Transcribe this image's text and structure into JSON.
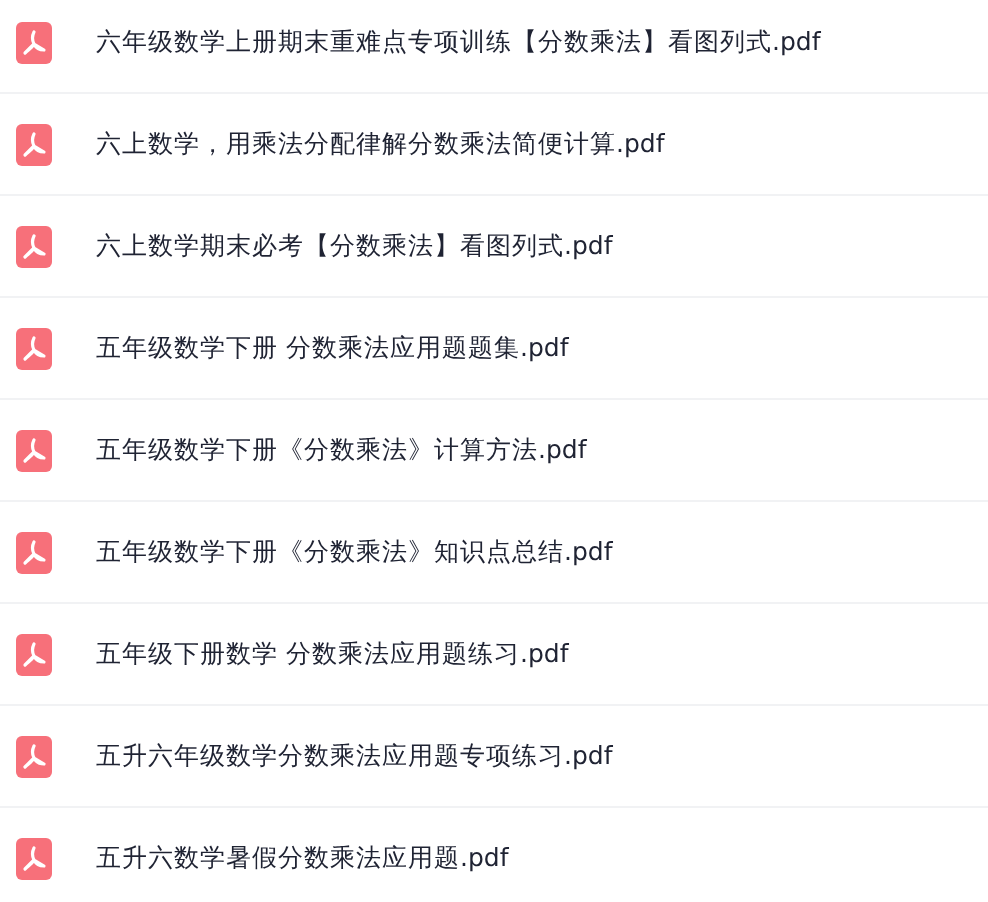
{
  "files": [
    {
      "name": "六年级数学上册期末重难点专项训练【分数乘法】看图列式.pdf"
    },
    {
      "name": "六上数学，用乘法分配律解分数乘法简便计算.pdf"
    },
    {
      "name": "六上数学期末必考【分数乘法】看图列式.pdf"
    },
    {
      "name": "五年级数学下册 分数乘法应用题题集.pdf"
    },
    {
      "name": "五年级数学下册《分数乘法》计算方法.pdf"
    },
    {
      "name": "五年级数学下册《分数乘法》知识点总结.pdf"
    },
    {
      "name": "五年级下册数学 分数乘法应用题练习.pdf"
    },
    {
      "name": "五升六年级数学分数乘法应用题专项练习.pdf"
    },
    {
      "name": "五升六数学暑假分数乘法应用题.pdf"
    }
  ]
}
